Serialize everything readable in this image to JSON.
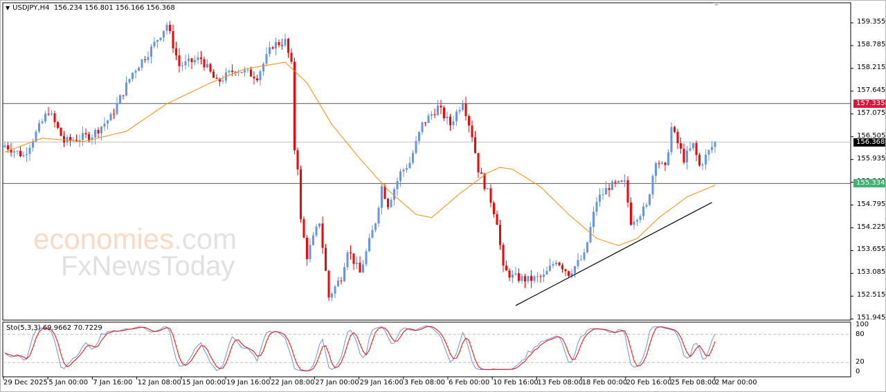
{
  "header": {
    "symbol": "USDJPY,H4",
    "ohlc": "156.234 156.801 156.166 156.368"
  },
  "watermark": {
    "line1": "economies",
    "line1_suffix": ".com",
    "line2": "FxNewsToday"
  },
  "price_axis": {
    "ticks": [
      "159.355",
      "158.785",
      "158.215",
      "157.645",
      "157.075",
      "156.505",
      "155.935",
      "155.365",
      "154.795",
      "154.225",
      "153.655",
      "153.085",
      "152.515",
      "151.945"
    ],
    "tick_values": [
      159.355,
      158.785,
      158.215,
      157.645,
      157.075,
      156.505,
      155.935,
      155.365,
      154.795,
      154.225,
      153.655,
      153.085,
      152.515,
      151.945
    ]
  },
  "levels": [
    {
      "label": "157.335",
      "value": 157.335,
      "color": "#dc143c",
      "line_color": "#555555"
    },
    {
      "label": "156.368",
      "value": 156.368,
      "color": "#000000",
      "line_color": "#c0c0c0"
    },
    {
      "label": "155.334",
      "value": 155.334,
      "color": "#3cb371",
      "line_color": "#555555"
    }
  ],
  "stochastic": {
    "label": "Sto(5,3,3) 69.9662 70.7229",
    "levels": [
      "100",
      "80",
      "20",
      "0"
    ],
    "k_color": "#6495ed",
    "d_color": "#ff0000"
  },
  "time_axis": [
    "29 Dec 2025",
    "5 Jan 00:00",
    "7 Jan 16:00",
    "12 Jan 08:00",
    "15 Jan 00:00",
    "19 Jan 16:00",
    "22 Jan 08:00",
    "27 Jan 00:00",
    "29 Jan 16:00",
    "3 Feb 08:00",
    "6 Feb 00:00",
    "10 Feb 16:00",
    "13 Feb 08:00",
    "18 Feb 00:00",
    "20 Feb 16:00",
    "25 Feb 08:00",
    "2 Mar 00:00"
  ],
  "colors": {
    "up": "#6495ed",
    "down": "#ff0000",
    "ma": "#ff8c00",
    "trend": "#000000"
  },
  "chart_data": {
    "type": "candlestick",
    "title": "USDJPY,H4",
    "ylim": [
      151.945,
      159.6
    ],
    "bars": 229,
    "close_path": [
      [
        0,
        156.29
      ],
      [
        6,
        156.03
      ],
      [
        14,
        157.16
      ],
      [
        19,
        156.38
      ],
      [
        28,
        156.55
      ],
      [
        34,
        156.99
      ],
      [
        41,
        158.11
      ],
      [
        47,
        158.71
      ],
      [
        52,
        159.32
      ],
      [
        56,
        158.28
      ],
      [
        63,
        158.46
      ],
      [
        68,
        157.85
      ],
      [
        74,
        158.2
      ],
      [
        81,
        158.02
      ],
      [
        86,
        158.8
      ],
      [
        90,
        158.89
      ],
      [
        92,
        158.28
      ],
      [
        93,
        156.2
      ],
      [
        94,
        155.77
      ],
      [
        95,
        154.39
      ],
      [
        97,
        153.52
      ],
      [
        101,
        154.39
      ],
      [
        104,
        152.49
      ],
      [
        108,
        153.0
      ],
      [
        110,
        153.7
      ],
      [
        114,
        153.09
      ],
      [
        119,
        154.39
      ],
      [
        121,
        155.26
      ],
      [
        123,
        154.82
      ],
      [
        127,
        155.6
      ],
      [
        130,
        155.86
      ],
      [
        134,
        156.81
      ],
      [
        139,
        157.24
      ],
      [
        143,
        156.81
      ],
      [
        147,
        157.42
      ],
      [
        150,
        156.55
      ],
      [
        152,
        155.69
      ],
      [
        156,
        154.91
      ],
      [
        158,
        154.39
      ],
      [
        160,
        153.18
      ],
      [
        163,
        153.0
      ],
      [
        168,
        152.92
      ],
      [
        173,
        153.0
      ],
      [
        177,
        153.43
      ],
      [
        181,
        153.09
      ],
      [
        186,
        153.52
      ],
      [
        190,
        154.91
      ],
      [
        194,
        155.26
      ],
      [
        199,
        155.34
      ],
      [
        201,
        154.39
      ],
      [
        206,
        154.74
      ],
      [
        209,
        155.95
      ],
      [
        212,
        155.69
      ],
      [
        214,
        156.73
      ],
      [
        218,
        155.95
      ],
      [
        221,
        156.29
      ],
      [
        223,
        155.77
      ],
      [
        228,
        156.368
      ]
    ],
    "moving_average": [
      [
        0,
        156.12
      ],
      [
        12,
        156.47
      ],
      [
        25,
        156.38
      ],
      [
        39,
        156.64
      ],
      [
        52,
        157.33
      ],
      [
        66,
        157.85
      ],
      [
        77,
        158.2
      ],
      [
        90,
        158.37
      ],
      [
        97,
        157.85
      ],
      [
        105,
        156.81
      ],
      [
        114,
        155.95
      ],
      [
        123,
        155.17
      ],
      [
        132,
        154.56
      ],
      [
        137,
        154.48
      ],
      [
        146,
        155.08
      ],
      [
        155,
        155.6
      ],
      [
        159,
        155.74
      ],
      [
        163,
        155.69
      ],
      [
        172,
        155.25
      ],
      [
        181,
        154.56
      ],
      [
        190,
        153.96
      ],
      [
        197,
        153.78
      ],
      [
        203,
        153.96
      ],
      [
        210,
        154.48
      ],
      [
        219,
        155.0
      ],
      [
        228,
        155.29
      ]
    ],
    "trendline": [
      [
        164,
        152.28
      ],
      [
        227,
        154.86
      ]
    ]
  }
}
